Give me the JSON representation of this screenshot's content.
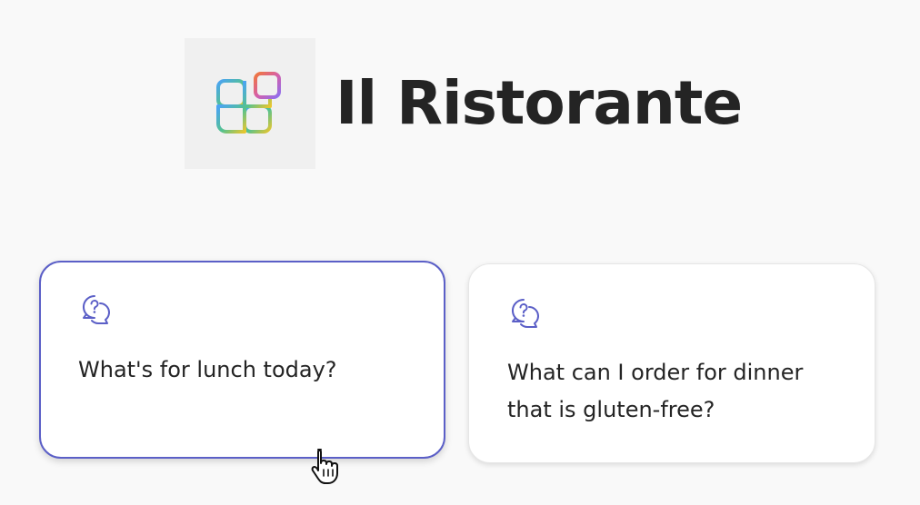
{
  "app": {
    "title": "Il Ristorante",
    "logo_icon": "apps-grid-icon"
  },
  "prompts": [
    {
      "icon": "chat-question-icon",
      "text": "What's for lunch today?",
      "state": "hovered"
    },
    {
      "icon": "chat-question-icon",
      "text": "What can I order for dinner that is gluten-free?",
      "state": "default"
    }
  ],
  "colors": {
    "accent": "#5b5fc7",
    "page_background": "#f9f9f9",
    "logo_background": "#f0f0f0",
    "text": "#242424"
  }
}
